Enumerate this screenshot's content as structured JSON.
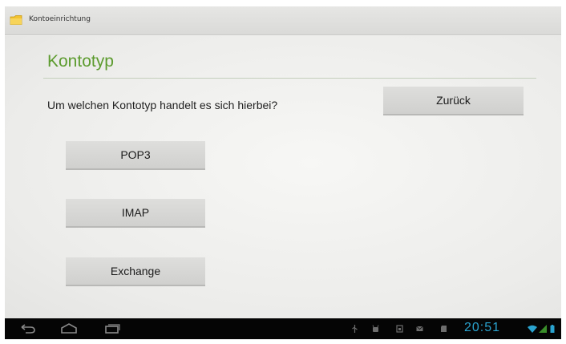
{
  "actionbar": {
    "title": "Kontoeinrichtung",
    "icon": "folder-icon"
  },
  "page": {
    "title": "Kontotyp",
    "question": "Um welchen Kontotyp handelt es sich hierbei?"
  },
  "buttons": {
    "back": "Zurück",
    "pop3": "POP3",
    "imap": "IMAP",
    "exchange": "Exchange"
  },
  "statusbar": {
    "time": "20:51"
  },
  "colors": {
    "accent": "#5c9b2e",
    "clock": "#2aa3cf",
    "navbar": "#050505"
  }
}
